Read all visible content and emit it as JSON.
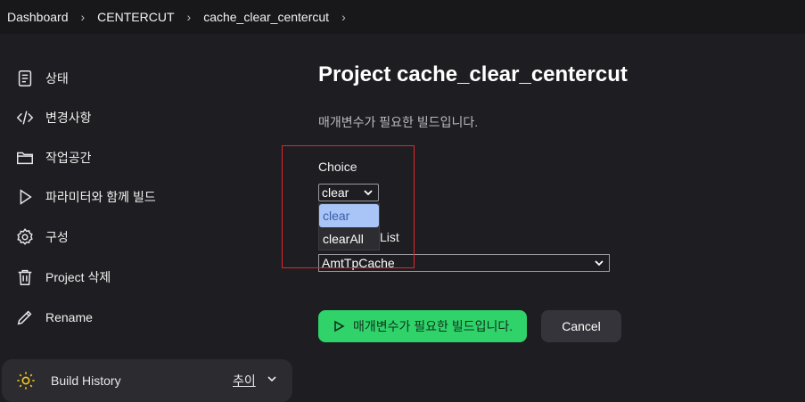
{
  "breadcrumb": {
    "items": [
      "Dashboard",
      "CENTERCUT",
      "cache_clear_centercut"
    ]
  },
  "sidebar": {
    "items": [
      {
        "label": "상태",
        "icon": "document-icon"
      },
      {
        "label": "변경사항",
        "icon": "code-icon"
      },
      {
        "label": "작업공간",
        "icon": "folder-icon"
      },
      {
        "label": "파라미터와 함께 빌드",
        "icon": "play-icon"
      },
      {
        "label": "구성",
        "icon": "gear-icon"
      },
      {
        "label": "Project 삭제",
        "icon": "trash-icon"
      },
      {
        "label": "Rename",
        "icon": "pencil-icon"
      }
    ],
    "build_history": {
      "label": "Build History",
      "trend": "추이",
      "icon": "sun-icon"
    }
  },
  "main": {
    "title": "Project cache_clear_centercut",
    "subtitle": "매개변수가 필요한 빌드입니다.",
    "choice": {
      "label": "Choice",
      "selected": "clear",
      "options": [
        "clear",
        "clearAll"
      ],
      "highlighted": "clear"
    },
    "list": {
      "label": "List",
      "selected": "AmtTpCache"
    },
    "build_button": "매개변수가 필요한 빌드입니다.",
    "cancel_button": "Cancel"
  },
  "colors": {
    "background": "#1e1e22",
    "accent_green": "#2fd36a",
    "highlight_box": "#e0252b"
  }
}
